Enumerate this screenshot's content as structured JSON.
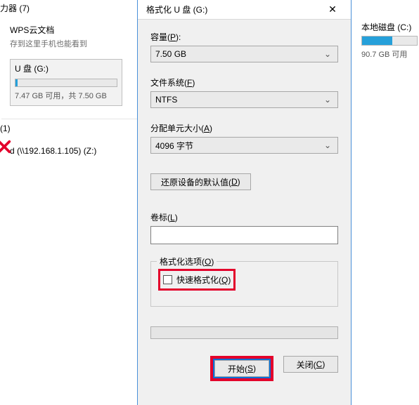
{
  "left": {
    "section1_header": "力器 (7)",
    "wps": {
      "name": "WPS云文档",
      "sub": "存到这里手机也能看到"
    },
    "usb": {
      "name": "U 盘 (G:)",
      "fill_pct": 2,
      "caption": "7.47 GB 可用，共 7.50 GB"
    },
    "section2_header": "(1)",
    "net": {
      "name": "d (\\\\192.168.1.105) (Z:)"
    }
  },
  "right": {
    "drive": {
      "name": "本地磁盘 (C:)",
      "fill_pct": 55,
      "caption": "90.7 GB 可用"
    }
  },
  "dlg": {
    "title": "格式化 U 盘 (G:)",
    "close_glyph": "✕",
    "capacity_label_pre": "容量(",
    "capacity_label_u": "P",
    "capacity_label_post": "):",
    "capacity_value": "7.50 GB",
    "fs_label_pre": "文件系统(",
    "fs_label_u": "F",
    "fs_label_post": ")",
    "fs_value": "NTFS",
    "alloc_label_pre": "分配单元大小(",
    "alloc_label_u": "A",
    "alloc_label_post": ")",
    "alloc_value": "4096 字节",
    "restore_btn_pre": "还原设备的默认值(",
    "restore_btn_u": "D",
    "restore_btn_post": ")",
    "volume_label_pre": "卷标(",
    "volume_label_u": "L",
    "volume_label_post": ")",
    "volume_value": "",
    "opts_legend_pre": "格式化选项(",
    "opts_legend_u": "O",
    "opts_legend_post": ")",
    "quick_pre": "快速格式化(",
    "quick_u": "Q",
    "quick_post": ")",
    "start_pre": "开始(",
    "start_u": "S",
    "start_post": ")",
    "close_pre": "关闭(",
    "close_u": "C",
    "close_post": ")",
    "caret": "⌄"
  }
}
